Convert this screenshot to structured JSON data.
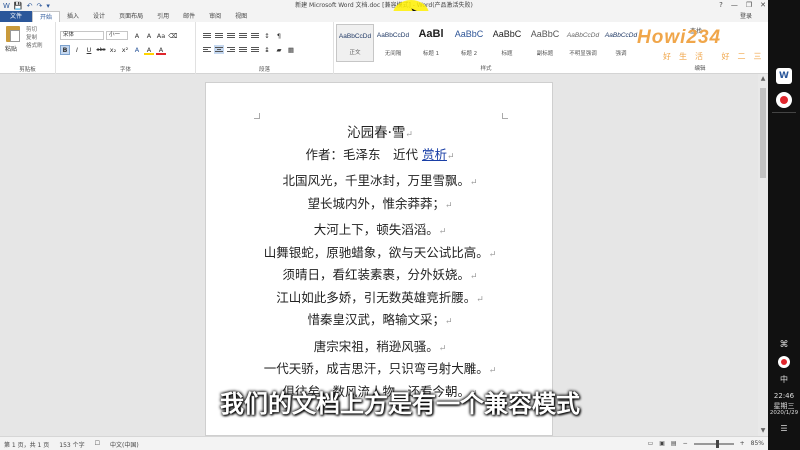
{
  "window": {
    "title": "新建 Microsoft Word 文档.doc [兼容模式] - Word(产品激活失败)",
    "login": "登录",
    "controls": [
      "?",
      "—",
      "❐",
      "✕"
    ]
  },
  "qat": [
    "W",
    "💾",
    "↶",
    "↷",
    "▾"
  ],
  "tabs": [
    "文件",
    "开始",
    "插入",
    "设计",
    "页面布局",
    "引用",
    "邮件",
    "审阅",
    "视图"
  ],
  "ribbon": {
    "clipboard": {
      "paste": "粘贴",
      "cut": "剪切",
      "copy": "复制",
      "format_painter": "格式刷",
      "label": "剪贴板"
    },
    "font": {
      "name": "宋体",
      "size": "小一",
      "label": "字体",
      "buttons": [
        "B",
        "I",
        "U",
        "abc",
        "x₂",
        "x²",
        "A",
        "A",
        "A"
      ]
    },
    "paragraph": {
      "label": "段落"
    },
    "styles": {
      "label": "样式",
      "items": [
        {
          "sample": "AaBbCcDd",
          "name": "正文"
        },
        {
          "sample": "AaBbCcDd",
          "name": "无间隔"
        },
        {
          "sample": "AaBl",
          "name": "标题 1"
        },
        {
          "sample": "AaBbC",
          "name": "标题 2"
        },
        {
          "sample": "AaBbC",
          "name": "标题"
        },
        {
          "sample": "AaBbC",
          "name": "副标题"
        },
        {
          "sample": "AaBbCcDd",
          "name": "不明显强调"
        },
        {
          "sample": "AaBbCcDd",
          "name": "强调"
        }
      ]
    },
    "editing": {
      "find": "查找",
      "label": "编辑"
    }
  },
  "watermark": {
    "brand": "Howi234",
    "slogan": "好生活 好二三"
  },
  "document": {
    "title": "沁园春·雪",
    "author_prefix": "作者：毛泽东　近代",
    "author_link": "赏析",
    "stanza1": [
      "北国风光，千里冰封，万里雪飘。",
      "望长城内外，惟余莽莽；"
    ],
    "stanza2": [
      "大河上下，顿失滔滔。",
      "山舞银蛇，原驰蜡象，欲与天公试比高。",
      "须晴日，看红装素裹，分外妖娆。",
      "江山如此多娇，引无数英雄竞折腰。",
      "惜秦皇汉武，略输文采；"
    ],
    "stanza3": [
      "唐宗宋祖，稍逊风骚。",
      "一代天骄，成吉思汗，只识弯弓射大雕。",
      "俱往矣，数风流人物，还看今朝。"
    ]
  },
  "subtitle": "我们的文档上方是有一个兼容模式",
  "statusbar": {
    "page": "第 1 页，共 1 页",
    "words": "153 个字",
    "lang": "中文(中国)",
    "zoom": "85%"
  },
  "system": {
    "ime": "中",
    "time": "22:46",
    "weekday": "星期三",
    "date": "2020/1/29"
  },
  "colors": {
    "word_blue": "#2b579a",
    "link": "#1a3fa6",
    "record_red": "#e0262d",
    "watermark": "#f0a64a"
  }
}
